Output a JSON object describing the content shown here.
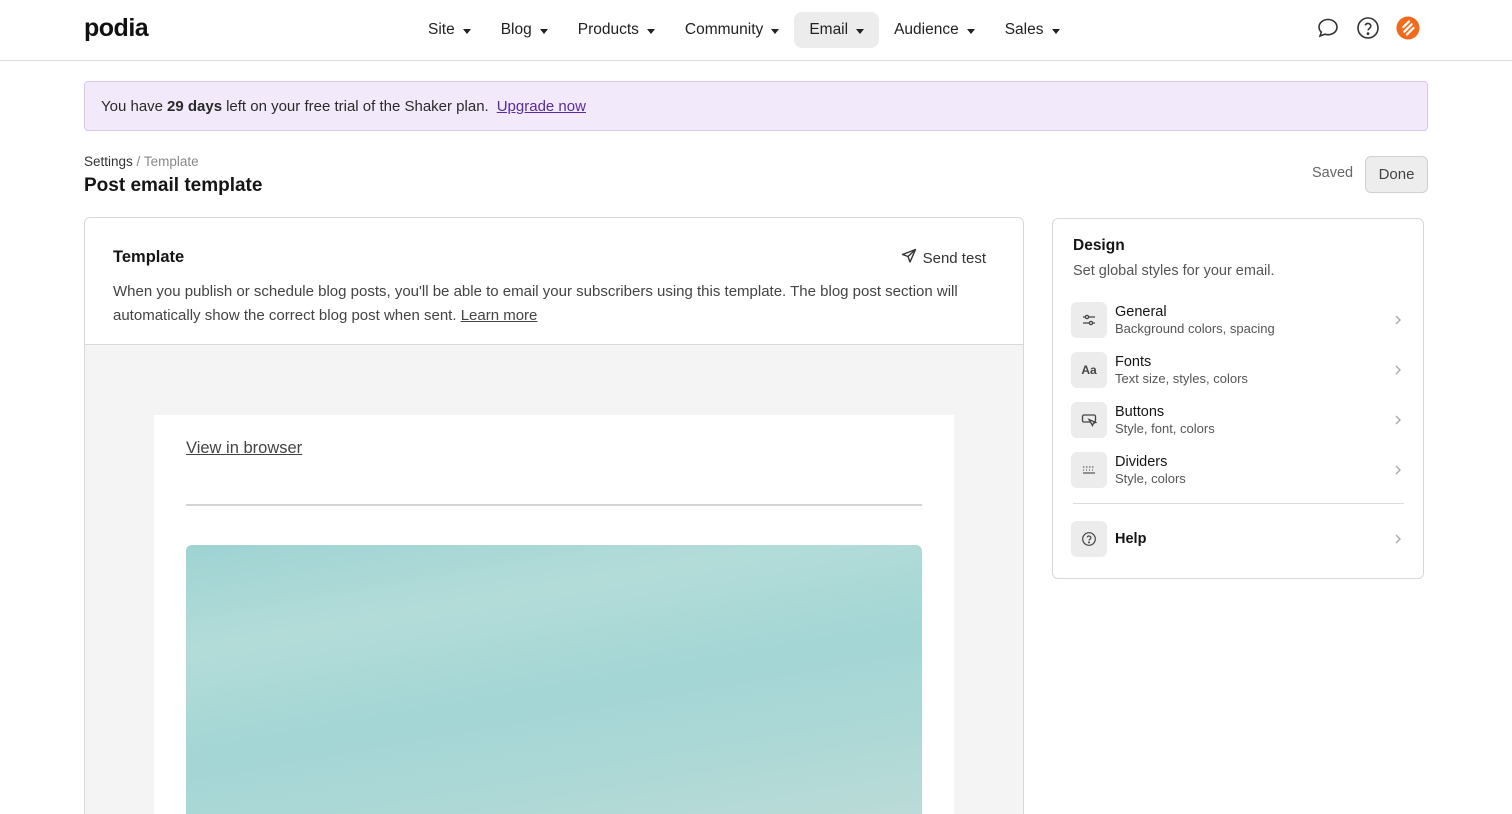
{
  "app": {
    "logo": "podia"
  },
  "nav": {
    "items": [
      {
        "label": "Site"
      },
      {
        "label": "Blog"
      },
      {
        "label": "Products"
      },
      {
        "label": "Community"
      },
      {
        "label": "Email",
        "active": true
      },
      {
        "label": "Audience"
      },
      {
        "label": "Sales"
      }
    ],
    "icons": [
      "chat-icon",
      "help-icon",
      "avatar"
    ]
  },
  "banner": {
    "prefix": "You have",
    "days": "29 days",
    "suffix": "left on your free trial of the Shaker plan.",
    "link": "Upgrade now"
  },
  "breadcrumb": {
    "parent": "Settings",
    "separator": "/",
    "current": "Template"
  },
  "page": {
    "title": "Post email template",
    "saved_status": "Saved",
    "done_label": "Done"
  },
  "template": {
    "title": "Template",
    "send_test": "Send test",
    "description": "When you publish or schedule blog posts, you'll be able to email your subscribers using this template. The blog post section will automatically show the correct blog post when sent.",
    "learn_more": "Learn more",
    "preview": {
      "view_in_browser": "View in browser"
    }
  },
  "design": {
    "title": "Design",
    "subtitle": "Set global styles for your email.",
    "items": [
      {
        "label": "General",
        "desc": "Background colors, spacing",
        "icon": "sliders-icon"
      },
      {
        "label": "Fonts",
        "desc": "Text size, styles, colors",
        "icon": "Aa"
      },
      {
        "label": "Buttons",
        "desc": "Style, font, colors",
        "icon": "button-cursor-icon"
      },
      {
        "label": "Dividers",
        "desc": "Style, colors",
        "icon": "dividers-icon"
      }
    ],
    "help": {
      "label": "Help",
      "icon": "help-circle-icon"
    }
  },
  "colors": {
    "banner_bg": "#f2eafa",
    "banner_border": "#d9c6ef",
    "link_purple": "#5b2a9e",
    "avatar_orange": "#f26b1d",
    "nav_active_bg": "#ececec"
  }
}
